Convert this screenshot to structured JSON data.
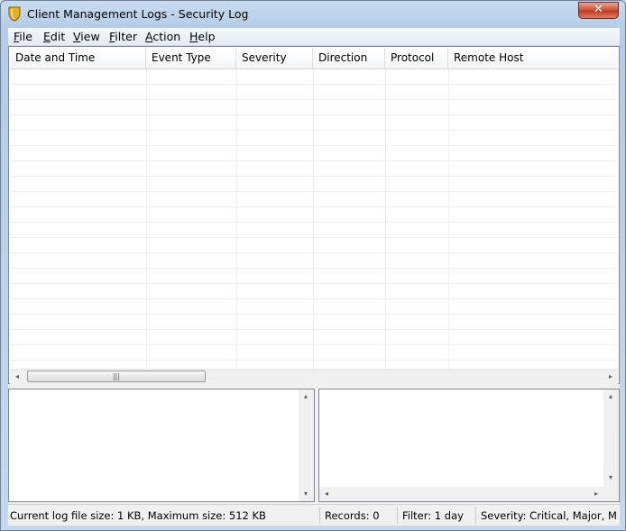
{
  "window": {
    "title": "Client Management Logs - Security Log",
    "close_label": "✕"
  },
  "menu": [
    {
      "key": "F",
      "rest": "ile"
    },
    {
      "key": "E",
      "rest": "dit"
    },
    {
      "key": "V",
      "rest": "iew"
    },
    {
      "key": "F",
      "rest": "ilter"
    },
    {
      "key": "A",
      "rest": "ction"
    },
    {
      "key": "H",
      "rest": "elp"
    }
  ],
  "columns": [
    "Date and Time",
    "Event Type",
    "Severity",
    "Direction",
    "Protocol",
    "Remote Host"
  ],
  "scroll": {
    "left": "◂",
    "right": "▸",
    "up": "▴",
    "down": "▾",
    "grip": "|||"
  },
  "status": {
    "log_size": "Current log file size: 1 KB, Maximum size: 512 KB",
    "records": "Records: 0",
    "filter": "Filter: 1 day",
    "severity": "Severity: Critical, Major, Mino"
  },
  "colors": {
    "close": "#c13a22",
    "icon": "#e6b021"
  }
}
